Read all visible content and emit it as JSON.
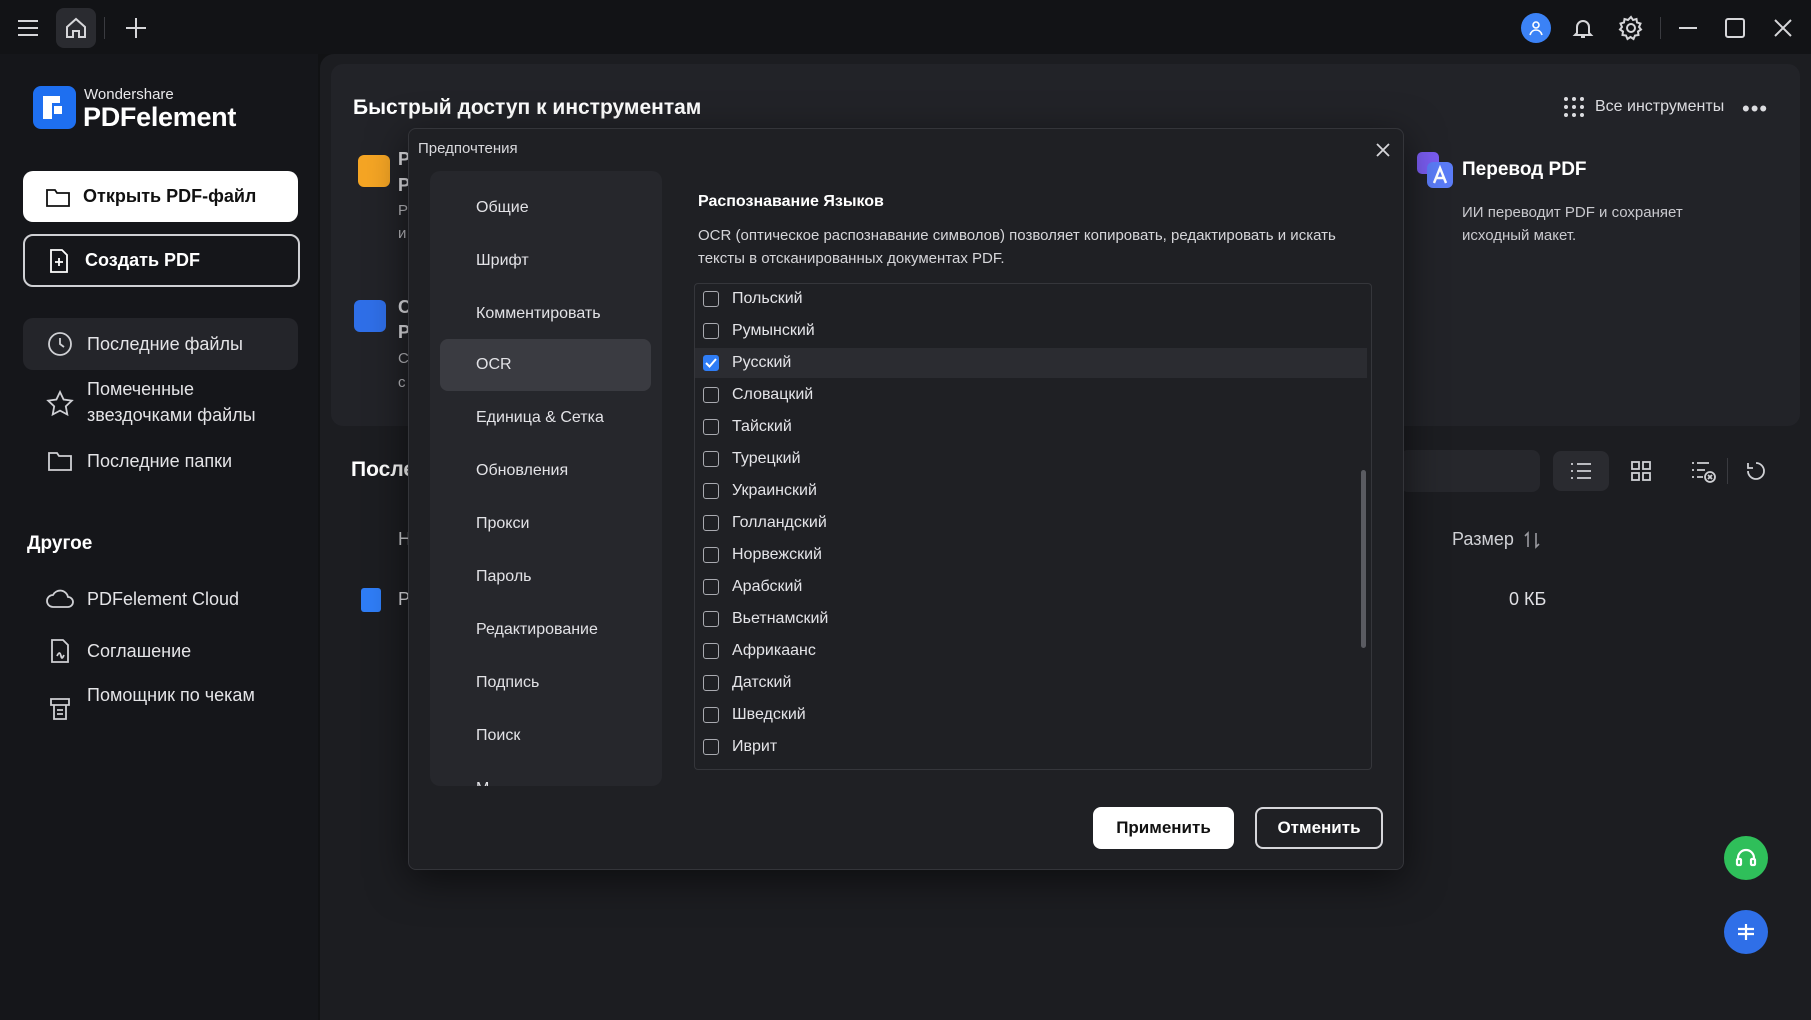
{
  "titlebar": {
    "icons": [
      "menu-icon",
      "home-icon",
      "plus-icon",
      "avatar-icon",
      "bell-icon",
      "gear-icon",
      "minimize-icon",
      "maximize-icon",
      "close-icon"
    ]
  },
  "brand": {
    "company": "Wondershare",
    "product": "PDFelement"
  },
  "sidebar": {
    "open_label": "Открыть PDF-файл",
    "create_label": "Создать PDF",
    "items": [
      {
        "label": "Последние файлы",
        "icon": "clock-icon"
      },
      {
        "label": "Помеченные звездочками файлы",
        "icon": "star-icon"
      },
      {
        "label": "Последние папки",
        "icon": "folder-icon"
      }
    ],
    "other_heading": "Другое",
    "other_items": [
      {
        "label": "PDFelement Cloud",
        "icon": "cloud-icon"
      },
      {
        "label": "Соглашение",
        "icon": "document-icon"
      },
      {
        "label": "Помощник по чекам",
        "icon": "receipt-icon"
      }
    ]
  },
  "main": {
    "quick_access_title": "Быстрый доступ к инструментам",
    "all_tools_label": "Все инструменты",
    "translate": {
      "title": "Перевод PDF",
      "desc": "ИИ переводит PDF и сохраняет исходный макет."
    },
    "partial_tools": [
      {
        "l1": "Р",
        "l2": "Р",
        "l3": "Р",
        "l4": "и"
      },
      {
        "l1": "С",
        "l2": "Р",
        "l3": "С",
        "l4": "с"
      }
    ],
    "recent_title": "После",
    "col_name": "Н",
    "col_size": "Размер",
    "file_initial": "Р",
    "file_size": "0 КБ"
  },
  "dialog": {
    "title": "Предпочтения",
    "nav": [
      "Общие",
      "Шрифт",
      "Комментировать",
      "OCR",
      "Единица & Сетка",
      "Обновления",
      "Прокси",
      "Пароль",
      "Редактирование",
      "Подпись",
      "Поиск",
      "М"
    ],
    "active_nav": "OCR",
    "section_title": "Распознавание Языков",
    "section_desc": "OCR (оптическое распознавание символов) позволяет копировать, редактировать и искать тексты в отсканированных документах PDF.",
    "languages": [
      {
        "name": "Польский",
        "checked": false
      },
      {
        "name": "Румынский",
        "checked": false
      },
      {
        "name": "Русский",
        "checked": true
      },
      {
        "name": "Словацкий",
        "checked": false
      },
      {
        "name": "Тайский",
        "checked": false
      },
      {
        "name": "Турецкий",
        "checked": false
      },
      {
        "name": "Украинский",
        "checked": false
      },
      {
        "name": "Голландский",
        "checked": false
      },
      {
        "name": "Норвежский",
        "checked": false
      },
      {
        "name": "Арабский",
        "checked": false
      },
      {
        "name": "Вьетнамский",
        "checked": false
      },
      {
        "name": "Африкаанс",
        "checked": false
      },
      {
        "name": "Датский",
        "checked": false
      },
      {
        "name": "Шведский",
        "checked": false
      },
      {
        "name": "Иврит",
        "checked": false
      }
    ],
    "apply_label": "Применить",
    "cancel_label": "Отменить"
  },
  "colors": {
    "accent": "#2f7df6",
    "support_green": "#2fbf5a",
    "chat_blue": "#2f6fe8"
  }
}
